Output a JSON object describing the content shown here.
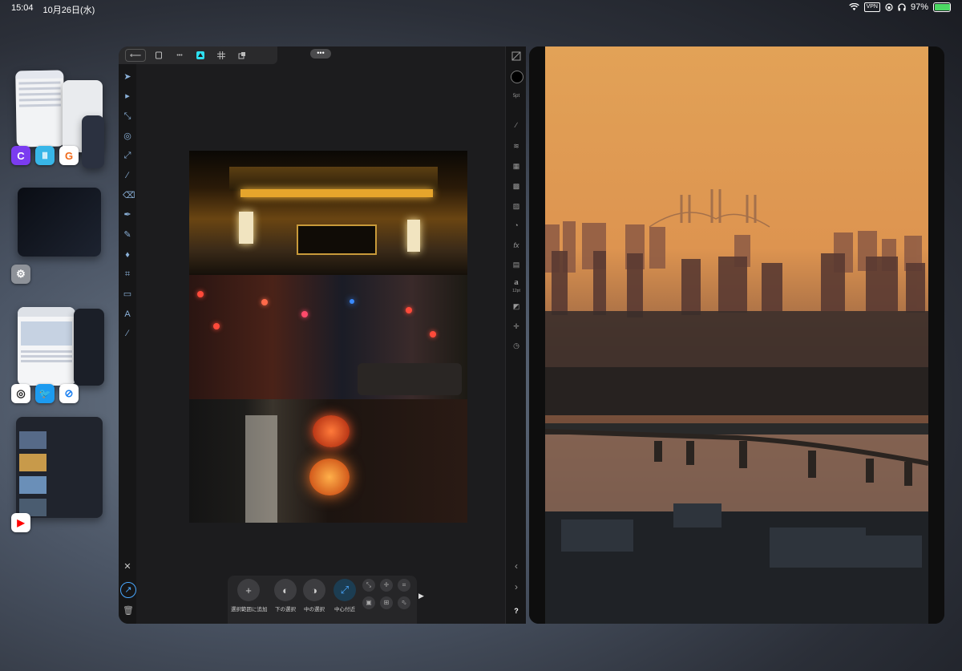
{
  "status_bar": {
    "time": "15:04",
    "date": "10月26日(水)",
    "vpn_label": "VPN",
    "battery_percent": "97%",
    "battery_level": 0.97,
    "icons": [
      "wifi-icon",
      "vpn-badge",
      "lock-rotation-icon",
      "headphones-icon",
      "battery-charging-icon"
    ]
  },
  "app_switcher": {
    "groups": [
      {
        "apps": [
          "C",
          "Ⅲ",
          "G"
        ],
        "app_names": [
          "craft-app-icon",
          "bars-app-icon",
          "goodnotes-app-icon"
        ]
      },
      {
        "apps": [
          "⚙"
        ],
        "app_names": [
          "settings-app-icon"
        ]
      },
      {
        "apps": [
          "◎",
          "🐦",
          "⊘"
        ],
        "app_names": [
          "opera-app-icon",
          "twitter-app-icon",
          "safari-app-icon"
        ]
      },
      {
        "apps": [
          "▶"
        ],
        "app_names": [
          "youtube-app-icon"
        ]
      }
    ]
  },
  "editor": {
    "toolbar_icons": [
      "back-arrow-icon",
      "document-icon",
      "more-icon",
      "persona-photo-icon",
      "grid-icon",
      "export-icon"
    ],
    "back_label": "⟵",
    "more_label": "•••",
    "multitask_dots": "•••",
    "left_tools": [
      "move-tool-icon",
      "node-tool-icon",
      "crop-artboard-icon",
      "rotate-icon",
      "transform-icon",
      "brush-icon",
      "eraser-icon",
      "pen-tool-icon",
      "pencil-tool-icon",
      "fill-icon",
      "crop-tool-icon",
      "rectangle-tool-icon",
      "text-frame-icon",
      "color-picker-icon"
    ],
    "bottom_left_icons": [
      "close-icon",
      "assist-icon",
      "trash-icon"
    ],
    "right_tools": [
      "layers-toggle-icon",
      "color-swatch-icon",
      "stroke-label",
      "brush-panel-icon",
      "layers-icon",
      "adjust-icon",
      "swatches-icon",
      "effects-icon",
      "fx-icon",
      "styles-icon",
      "text-style-icon",
      "transform-panel-icon",
      "navigator-icon",
      "history-icon"
    ],
    "stroke_label": "5pt",
    "text_tool_label": "a",
    "text_tool_sub": "12pt",
    "fx_label": "fx",
    "help_label": "?",
    "prev_label": "‹",
    "next_label": "›",
    "context_bar": {
      "buttons": [
        {
          "icon": "+",
          "label": "選択範囲に追加"
        },
        {
          "icon": "◐",
          "label": "下の選択"
        },
        {
          "icon": "◑",
          "label": "中の選択"
        },
        {
          "icon": "⤢",
          "label": "中心付近"
        }
      ],
      "expand_arrow": "▶"
    }
  },
  "colors": {
    "accent": "#2ee0f0",
    "tool_tint": "#8ab0d8",
    "window_bg": "#1c1c1e"
  }
}
